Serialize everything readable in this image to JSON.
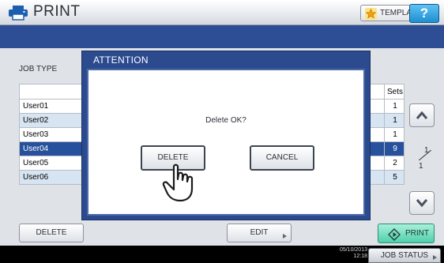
{
  "header": {
    "title": "PRINT",
    "template_label": "TEMPLATE",
    "help_label": "?"
  },
  "job_type_label": "JOB TYPE",
  "table": {
    "sets_header": "Sets",
    "rows": [
      {
        "name": "User01",
        "sets": "1",
        "state": "normal"
      },
      {
        "name": "User02",
        "sets": "1",
        "state": "alt"
      },
      {
        "name": "User03",
        "sets": "1",
        "state": "normal"
      },
      {
        "name": "User04",
        "sets": "9",
        "state": "selected"
      },
      {
        "name": "User05",
        "sets": "2",
        "state": "normal"
      },
      {
        "name": "User06",
        "sets": "5",
        "state": "alt"
      }
    ]
  },
  "pager": {
    "current": "1",
    "total": "1"
  },
  "bottom": {
    "delete_label": "DELETE",
    "edit_label": "EDIT",
    "print_label": "PRINT"
  },
  "status": {
    "date": "05/10/2013",
    "time": "12:18",
    "job_status_label": "JOB STATUS"
  },
  "dialog": {
    "title": "ATTENTION",
    "message": "Delete OK?",
    "delete_label": "DELETE",
    "cancel_label": "CANCEL"
  },
  "colors": {
    "title_band": "#2d4d95",
    "selected_row": "#27519c",
    "alt_row": "#d7e4f2",
    "print_button": "#4fd0ab",
    "help_button": "#1f8fd1"
  },
  "icons": [
    "printer-icon",
    "star-icon",
    "scroll-up-icon",
    "scroll-down-icon",
    "print-diamond-icon",
    "pointing-hand-icon"
  ]
}
